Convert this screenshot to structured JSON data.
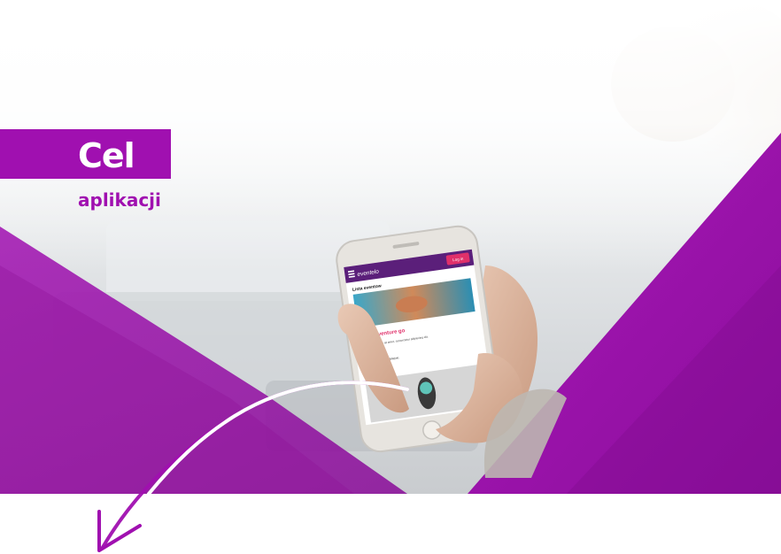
{
  "headline": {
    "title": "Cel",
    "subtitle": "aplikacji"
  },
  "phone_screen": {
    "logo": "eventelo",
    "login_button": "Log in",
    "list_title": "Lista eventow",
    "event_title": "Best adventure go",
    "event_desc": "Lorem ipsum dolor sit amet, consectetur adipiscing elit.",
    "event_date": "17.11.2018",
    "event_place": "Poznan Stadion Miejski",
    "event_button": "Zobacz"
  },
  "colors": {
    "brand_purple": "#a010b0",
    "accent_pink": "#e0306a",
    "background": "#ffffff"
  },
  "icons": [
    "curved-arrow-icon",
    "menu-icon"
  ]
}
